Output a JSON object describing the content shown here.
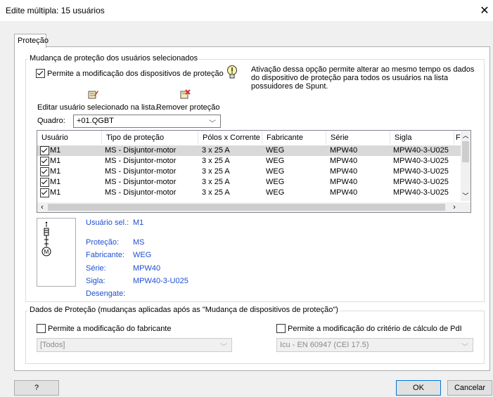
{
  "window": {
    "title": "Edite múltipla: 15 usuários"
  },
  "tabs": [
    {
      "label": "Proteção"
    }
  ],
  "group1": {
    "title": "Mudança de proteção dos usuários selecionados",
    "permit_checkbox_label": "Permite a modificação dos dispositivos de proteção",
    "permit_checked": true,
    "info_text": "Ativação dessa opção permite alterar ao mesmo tempo os dados do dispositivo de proteção para todos os usuários na lista possuidores de Spunt.",
    "edit_button_label": "Editar usuário selecionado na lista...",
    "remove_button_label": "Remover proteção",
    "quadro_label": "Quadro:",
    "quadro_value": "+01.QGBT"
  },
  "table": {
    "columns": [
      "Usuário",
      "Tipo de proteção",
      "Pólos x Corrente",
      "Fabricante",
      "Série",
      "Sigla",
      "F"
    ],
    "rows": [
      {
        "checked": true,
        "usuario": "M1",
        "tipo": "MS - Disjuntor-motor",
        "polos": "3 x 25 A",
        "fabricante": "WEG",
        "serie": "MPW40",
        "sigla": "MPW40-3-U025"
      },
      {
        "checked": true,
        "usuario": "M1",
        "tipo": "MS - Disjuntor-motor",
        "polos": "3 x 25 A",
        "fabricante": "WEG",
        "serie": "MPW40",
        "sigla": "MPW40-3-U025"
      },
      {
        "checked": true,
        "usuario": "M1",
        "tipo": "MS - Disjuntor-motor",
        "polos": "3 x 25 A",
        "fabricante": "WEG",
        "serie": "MPW40",
        "sigla": "MPW40-3-U025"
      },
      {
        "checked": true,
        "usuario": "M1",
        "tipo": "MS - Disjuntor-motor",
        "polos": "3 x 25 A",
        "fabricante": "WEG",
        "serie": "MPW40",
        "sigla": "MPW40-3-U025"
      },
      {
        "checked": true,
        "usuario": "M1",
        "tipo": "MS - Disjuntor-motor",
        "polos": "3 x 25 A",
        "fabricante": "WEG",
        "serie": "MPW40",
        "sigla": "MPW40-3-U025"
      }
    ]
  },
  "details": {
    "usuario_label": "Usuário sel.:",
    "usuario_value": "M1",
    "protecao_label": "Proteção:",
    "protecao_value": "MS",
    "fabricante_label": "Fabricante:",
    "fabricante_value": "WEG",
    "serie_label": "Série:",
    "serie_value": "MPW40",
    "sigla_label": "Sigla:",
    "sigla_value": "MPW40-3-U025",
    "desengate_label": "Desengate:"
  },
  "group2": {
    "title": "Dados de Proteção (mudanças aplicadas após as \"Mudança de dispositivos de proteção\")",
    "fabricante_checkbox_label": "Permite a modificação do fabricante",
    "fabricante_checked": false,
    "fabricante_select_value": "[Todos]",
    "pdi_checkbox_label": "Permite a modificação do critério de cálculo de PdI",
    "pdi_checked": false,
    "pdi_select_value": "Icu - EN 60947 (CEI 17.5)"
  },
  "footer": {
    "help_label": "?",
    "ok_label": "OK",
    "cancel_label": "Cancelar"
  },
  "colors": {
    "accent": "#0078d7",
    "detail_blue": "#1f4fd1",
    "selected_row": "#d9d9d9"
  }
}
